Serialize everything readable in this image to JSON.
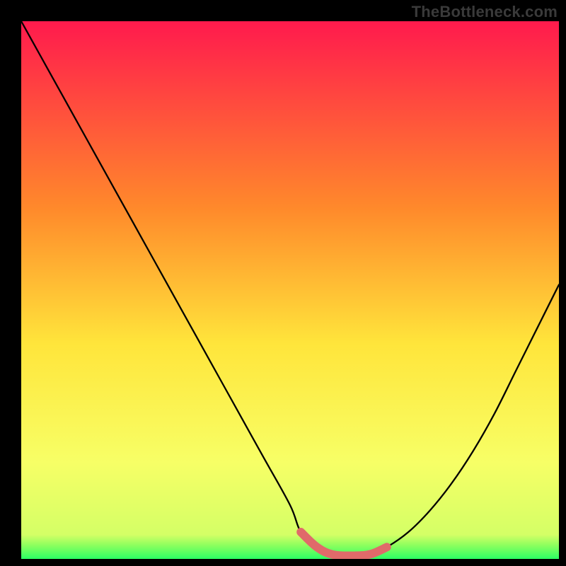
{
  "watermark": "TheBottleneck.com",
  "colors": {
    "frame": "#000000",
    "grad_top": "#ff1a4d",
    "grad_mid1": "#ff8a2b",
    "grad_mid2": "#ffe53b",
    "grad_low": "#f7ff66",
    "grad_bottom": "#2bff64",
    "curve": "#000000",
    "highlight": "#e06a6a"
  },
  "chart_data": {
    "type": "line",
    "title": "",
    "xlabel": "",
    "ylabel": "",
    "xlim": [
      0,
      100
    ],
    "ylim": [
      0,
      100
    ],
    "series": [
      {
        "name": "bottleneck-curve",
        "x": [
          0,
          5,
          10,
          15,
          20,
          25,
          30,
          35,
          40,
          45,
          50,
          52,
          55,
          58,
          62,
          65,
          68,
          72,
          76,
          80,
          84,
          88,
          92,
          96,
          100
        ],
        "values": [
          100,
          91,
          82,
          73,
          64,
          55,
          46,
          37,
          28,
          19,
          10,
          5,
          2.2,
          0.8,
          0.6,
          0.9,
          2.2,
          5,
          9,
          14,
          20,
          27,
          35,
          43,
          51
        ]
      },
      {
        "name": "highlight-segment",
        "x": [
          52,
          55,
          58,
          62,
          65,
          68
        ],
        "values": [
          5,
          2.2,
          0.8,
          0.6,
          0.9,
          2.2
        ]
      }
    ]
  }
}
